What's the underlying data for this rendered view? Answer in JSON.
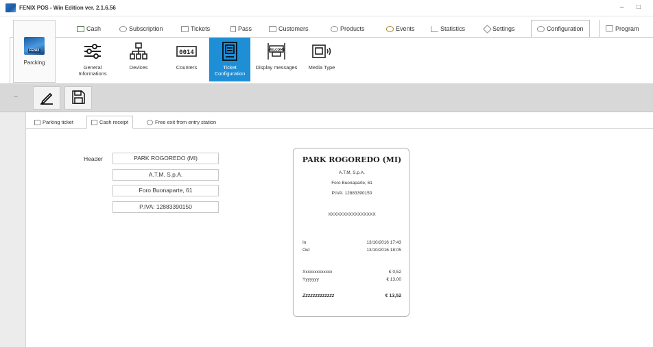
{
  "window": {
    "title": "FENIX POS - Win Edition ver. 2.1.6.56",
    "minimize_glyph": "–",
    "maximize_glyph": "□"
  },
  "tabs": [
    {
      "label": "Cash",
      "icon": "cash-icon"
    },
    {
      "label": "Subscription",
      "icon": "subscription-icon"
    },
    {
      "label": "Tickets",
      "icon": "tickets-icon"
    },
    {
      "label": "Pass",
      "icon": "pass-icon"
    },
    {
      "label": "Customers",
      "icon": "customers-icon"
    },
    {
      "label": "Products",
      "icon": "products-icon"
    },
    {
      "label": "Events",
      "icon": "events-icon"
    },
    {
      "label": "Statistics",
      "icon": "statistics-icon"
    },
    {
      "label": "Settings",
      "icon": "settings-icon"
    },
    {
      "label": "Configuration",
      "icon": "gear-icon",
      "active": true
    },
    {
      "label": "Program",
      "icon": "program-icon"
    }
  ],
  "app": {
    "logo_text": "FENIX",
    "module_label": "Parcking"
  },
  "ribbon": {
    "items": [
      {
        "label": "General Informations",
        "icon": "sliders-icon"
      },
      {
        "label": "Devices",
        "icon": "network-icon"
      },
      {
        "label": "Counters",
        "icon": "counter-icon",
        "counter_text": "0014"
      },
      {
        "label": "Ticket Configuration",
        "icon": "ticket-config-icon",
        "selected": true
      },
      {
        "label": "Display messages",
        "icon": "display-icon",
        "display_text": "WELCOME"
      },
      {
        "label": "Media Type",
        "icon": "media-icon"
      }
    ]
  },
  "toolbar": {
    "expand_glyph": "–",
    "edit_icon": "pencil-icon",
    "save_icon": "save-icon"
  },
  "subtabs": [
    {
      "label": "Parking ticket",
      "icon": "ticket-icon"
    },
    {
      "label": "Cash receipt",
      "icon": "receipt-icon",
      "active": true
    },
    {
      "label": "Free exit from entry station",
      "icon": "exit-icon"
    }
  ],
  "form": {
    "header_label": "Header",
    "header_lines": [
      "PARK ROGOREDO (MI)",
      "A.T.M. S.p.A.",
      "Foro Buonaparte, 61",
      "P.IVA: 12883390150"
    ]
  },
  "receipt": {
    "title": "PARK ROGOREDO (MI)",
    "lines": [
      "A.T.M. S.p.A.",
      "Foro Buonaparte, 61",
      "P.IVA: 12883390150"
    ],
    "code": "XXXXXXXXXXXXXXXX",
    "in_label": "In",
    "in_value": "13/10/2016 17:43",
    "out_label": "Out",
    "out_value": "13/10/2016 18:05",
    "item1_label": "Xxxxxxxxxxxxx",
    "item1_value": "€ 0,52",
    "item2_label": "Yyyyyyy",
    "item2_value": "€ 13,00",
    "total_label": "Zzzzzzzzzzzzz",
    "total_value": "€ 13,52"
  },
  "colors": {
    "accent": "#1e8ed6",
    "toolbar_bg": "#d8d8d8"
  }
}
